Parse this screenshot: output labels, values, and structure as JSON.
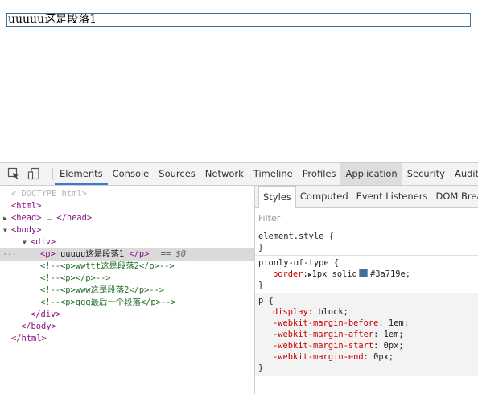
{
  "page": {
    "paragraph_text": "uuuuu这是段落1"
  },
  "devtools": {
    "tabs": [
      "Elements",
      "Console",
      "Sources",
      "Network",
      "Timeline",
      "Profiles",
      "Application",
      "Security",
      "Audits"
    ],
    "active_tab": "Elements",
    "highlighted_tab": "Application",
    "icons": [
      "inspect-element-icon",
      "device-mode-icon"
    ],
    "dom": {
      "doctype": "<!DOCTYPE html>",
      "html_open": "<html>",
      "head": {
        "open": "<head>",
        "ellipsis": "…",
        "close": "</head>"
      },
      "body_open": "<body>",
      "div_open": "<div>",
      "selected_p": {
        "open": "<p>",
        "text": " uuuuu这是段落1 ",
        "close": "</p>",
        "eq": "==",
        "ref": "$0"
      },
      "comments": [
        "<!--<p>wwttt这是段落2</p>-->",
        "<!--<p></p>-->",
        "<!--<p>www这是段落2</p>-->",
        "<!--<p>qqq最后一个段落</p>-->"
      ],
      "div_close": "</div>",
      "body_close": "</body>",
      "html_close": "</html>",
      "gutter_dots": "..."
    },
    "styles": {
      "tabs": [
        "Styles",
        "Computed",
        "Event Listeners",
        "DOM Breakpoints"
      ],
      "active_tab": "Styles",
      "filter_placeholder": "Filter",
      "element_style": {
        "selector": "element.style {",
        "close": "}"
      },
      "only_of_type": {
        "selector": "p:only-of-type {",
        "prop": "border",
        "value_prefix": "1px solid",
        "color_hex": "#3a719e",
        "close": "}"
      },
      "ua_rule": {
        "selector": "p {",
        "props": [
          {
            "name": "display",
            "value": "block;"
          },
          {
            "name": "-webkit-margin-before",
            "value": "1em;"
          },
          {
            "name": "-webkit-margin-after",
            "value": "1em;"
          },
          {
            "name": "-webkit-margin-start",
            "value": "0px;"
          },
          {
            "name": "-webkit-margin-end",
            "value": "0px;"
          }
        ],
        "close": "}"
      }
    }
  }
}
